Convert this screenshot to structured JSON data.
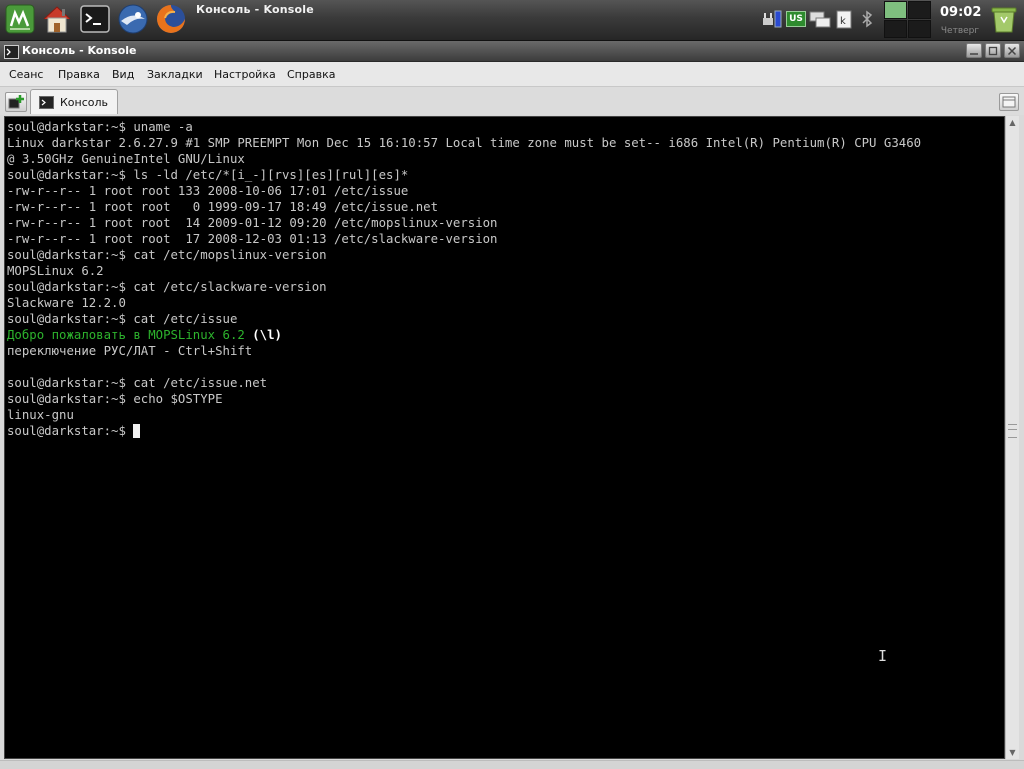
{
  "panel": {
    "launchers": [
      {
        "name": "mops-menu-icon"
      },
      {
        "name": "home-folder-icon"
      },
      {
        "name": "terminal-icon"
      },
      {
        "name": "mail-client-icon"
      },
      {
        "name": "firefox-icon"
      }
    ],
    "active_window_title": "Консоль - Konsole",
    "keyboard_layout": "US",
    "clock_time": "09:02",
    "clock_day": "Четверг",
    "colors": {
      "panel": "#3a3a3a",
      "pager_active": "#7fbf7f",
      "layout_badge": "#2e8b2e"
    }
  },
  "window": {
    "title": "Консоль - Konsole",
    "menu": [
      "Сеанс",
      "Правка",
      "Вид",
      "Закладки",
      "Настройка",
      "Справка"
    ],
    "tab_label": "Консоль"
  },
  "terminal": {
    "lines": [
      "soul@darkstar:~$ uname -a",
      "Linux darkstar 2.6.27.9 #1 SMP PREEMPT Mon Dec 15 16:10:57 Local time zone must be set-- i686 Intel(R) Pentium(R) CPU G3460",
      "@ 3.50GHz GenuineIntel GNU/Linux",
      "soul@darkstar:~$ ls -ld /etc/*[i_-][rvs][es][rul][es]*",
      "-rw-r--r-- 1 root root 133 2008-10-06 17:01 /etc/issue",
      "-rw-r--r-- 1 root root   0 1999-09-17 18:49 /etc/issue.net",
      "-rw-r--r-- 1 root root  14 2009-01-12 09:20 /etc/mopslinux-version",
      "-rw-r--r-- 1 root root  17 2008-12-03 01:13 /etc/slackware-version",
      "soul@darkstar:~$ cat /etc/mopslinux-version",
      "MOPSLinux 6.2",
      "soul@darkstar:~$ cat /etc/slackware-version",
      "Slackware 12.2.0",
      "soul@darkstar:~$ cat /etc/issue",
      "",
      "переключение РУС/ЛАТ - Ctrl+Shift",
      "",
      "soul@darkstar:~$ cat /etc/issue.net",
      "soul@darkstar:~$ echo $OSTYPE",
      "linux-gnu"
    ],
    "welcome_green": "Добро пожаловать в MOPSLinux 6.2",
    "welcome_bold": " (\\l)",
    "prompt": "soul@darkstar:~$ ",
    "colors": {
      "background": "#000000",
      "text": "#c8c8c8",
      "welcome": "#2db32d"
    }
  }
}
